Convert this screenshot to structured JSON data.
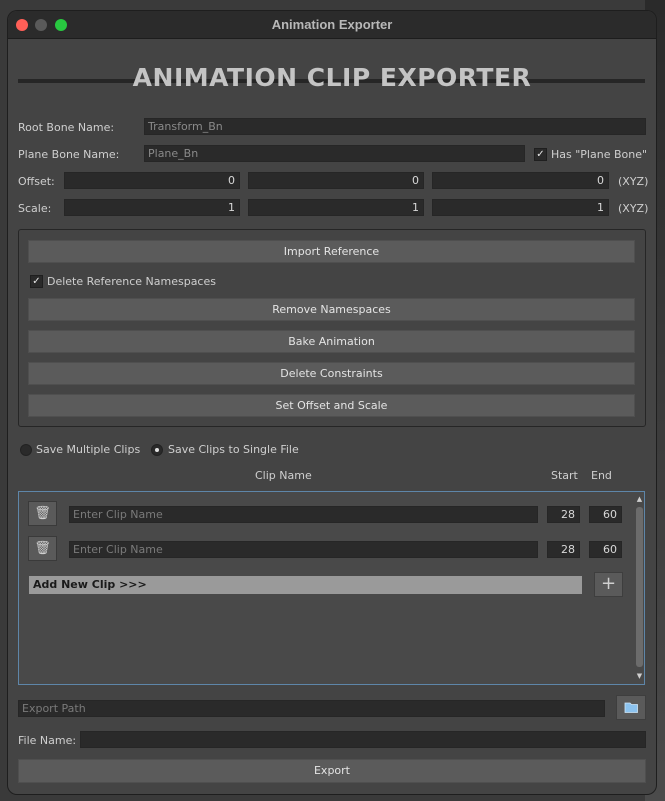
{
  "window": {
    "title": "Animation Exporter"
  },
  "heading": "ANIMATION CLIP EXPORTER",
  "fields": {
    "root_bone_label": "Root Bone Name:",
    "root_bone_value": "Transform_Bn",
    "plane_bone_label": "Plane Bone Name:",
    "plane_bone_value": "Plane_Bn",
    "has_plane_bone_label": "Has \"Plane Bone\"",
    "has_plane_bone_checked": true,
    "offset_label": "Offset:",
    "offset_values": [
      "0",
      "0",
      "0"
    ],
    "scale_label": "Scale:",
    "scale_values": [
      "1",
      "1",
      "1"
    ],
    "xyz_label": "(XYZ)"
  },
  "actions": {
    "import_reference": "Import Reference",
    "delete_ref_namespaces_label": "Delete Reference Namespaces",
    "delete_ref_namespaces_checked": true,
    "remove_namespaces": "Remove Namespaces",
    "bake_animation": "Bake Animation",
    "delete_constraints": "Delete Constraints",
    "set_offset_scale": "Set Offset and Scale"
  },
  "save_mode": {
    "multiple_label": "Save Multiple Clips",
    "single_label": "Save Clips to Single File",
    "selected": "single"
  },
  "clips": {
    "headers": {
      "name": "Clip Name",
      "start": "Start",
      "end": "End"
    },
    "rows": [
      {
        "placeholder": "Enter Clip Name",
        "start": "28",
        "end": "60"
      },
      {
        "placeholder": "Enter Clip Name",
        "start": "28",
        "end": "60"
      }
    ],
    "add_label": "Add New Clip >>>",
    "add_button": "+"
  },
  "export": {
    "path_placeholder": "Export Path",
    "file_name_label": "File Name:",
    "file_name_value": "",
    "export_button": "Export"
  },
  "icons": {
    "trash": "trash-icon",
    "plus": "plus-icon",
    "folder": "folder-icon",
    "check": "checkmark-icon"
  }
}
